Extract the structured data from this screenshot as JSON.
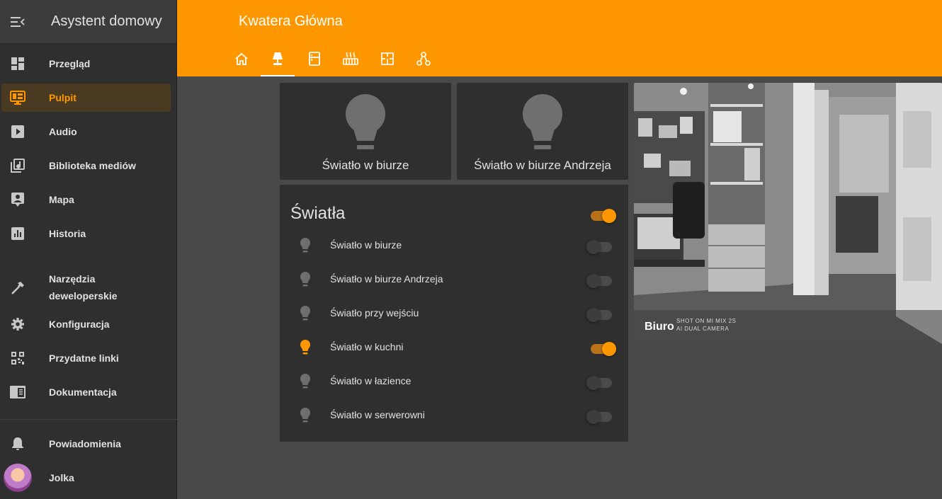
{
  "sidebar": {
    "title": "Asystent domowy",
    "items": [
      {
        "label": "Przegląd",
        "icon": "dashboard-icon"
      },
      {
        "label": "Pulpit",
        "icon": "monitor-dashboard-icon",
        "active": true
      },
      {
        "label": "Audio",
        "icon": "play-box-icon"
      },
      {
        "label": "Biblioteka mediów",
        "icon": "music-library-icon"
      },
      {
        "label": "Mapa",
        "icon": "account-box-icon"
      },
      {
        "label": "Historia",
        "icon": "chart-box-icon"
      },
      {
        "label": "Narzędzia deweloperskie",
        "label_line1": "Narzędzia",
        "label_line2": "deweloperskie",
        "icon": "hammer-icon"
      },
      {
        "label": "Konfiguracja",
        "icon": "gear-icon"
      },
      {
        "label": "Przydatne linki",
        "icon": "qrcode-icon"
      },
      {
        "label": "Dokumentacja",
        "icon": "book-icon"
      }
    ],
    "notifications_label": "Powiadomienia",
    "user_name": "Jolka"
  },
  "header": {
    "title": "Kwatera Główna",
    "tabs": [
      {
        "icon": "home-icon"
      },
      {
        "icon": "lamp-icon",
        "active": true
      },
      {
        "icon": "fridge-icon"
      },
      {
        "icon": "radiator-icon"
      },
      {
        "icon": "floor-plan-icon"
      },
      {
        "icon": "network-icon"
      }
    ]
  },
  "tiles": [
    {
      "label": "Światło w biurze",
      "state": "off"
    },
    {
      "label": "Światło w biurze Andrzeja",
      "state": "off"
    }
  ],
  "lights": {
    "title": "Światła",
    "group_state": "on",
    "entities": [
      {
        "label": "Światło w biurze",
        "state": "off"
      },
      {
        "label": "Światło w biurze Andrzeja",
        "state": "off"
      },
      {
        "label": "Światło przy wejściu",
        "state": "off"
      },
      {
        "label": "Światło w kuchni",
        "state": "on"
      },
      {
        "label": "Światło w łazience",
        "state": "off"
      },
      {
        "label": "Światło w serwerowni",
        "state": "off"
      }
    ]
  },
  "camera": {
    "name": "Biuro",
    "watermark_line1": "SHOT ON MI MIX 2S",
    "watermark_line2": "AI DUAL CAMERA"
  },
  "colors": {
    "accent": "#ff9800",
    "sidebar": "#2f2f2f",
    "background": "#494949",
    "card": "#2f2f2f",
    "icon_off": "#6f6f6f"
  }
}
